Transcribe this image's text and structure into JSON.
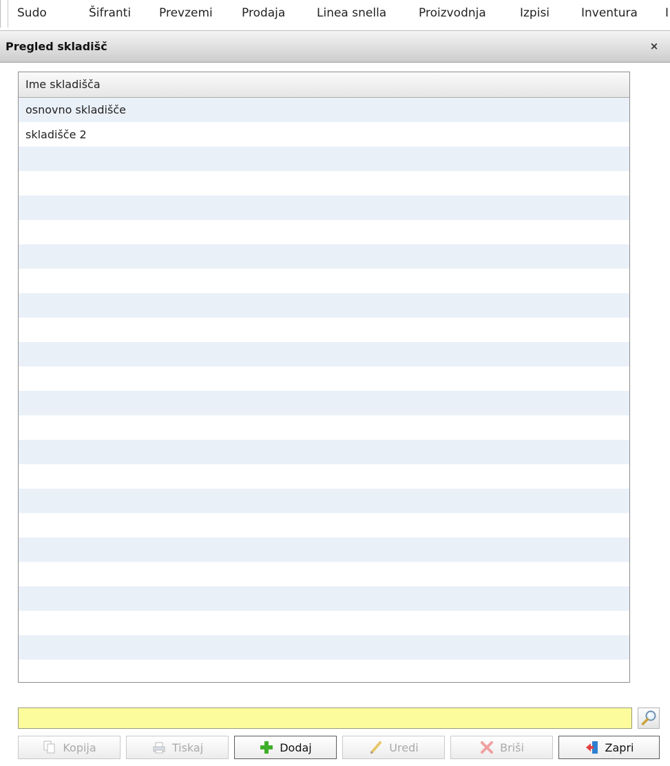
{
  "menu": {
    "items": [
      "Sudo",
      "Šifranti",
      "Prevzemi",
      "Prodaja",
      "Linea snella",
      "Proizvodnja",
      "Izpisi",
      "Inventura",
      "I"
    ]
  },
  "window": {
    "title": "Pregled skladišč",
    "close_label": "×"
  },
  "grid": {
    "column_header": "Ime skladišča",
    "rows": [
      "osnovno skladišče",
      "skladišče 2"
    ]
  },
  "search": {
    "value": ""
  },
  "toolbar": {
    "kopija": "Kopija",
    "tiskaj": "Tiskaj",
    "dodaj": "Dodaj",
    "uredi": "Uredi",
    "brisi": "Briši",
    "zapri": "Zapri"
  },
  "colors": {
    "search_bg": "#fdfc9c",
    "row_alt": "#eaf0f8",
    "add_green": "#3fae2a",
    "delete_red": "#e04040",
    "exit_blue": "#2f7fd0"
  },
  "icons": {
    "kopija": "copy-icon",
    "tiskaj": "print-icon",
    "dodaj": "plus-icon",
    "uredi": "pencil-icon",
    "brisi": "delete-x-icon",
    "zapri": "exit-door-icon",
    "search": "magnifier-icon"
  }
}
